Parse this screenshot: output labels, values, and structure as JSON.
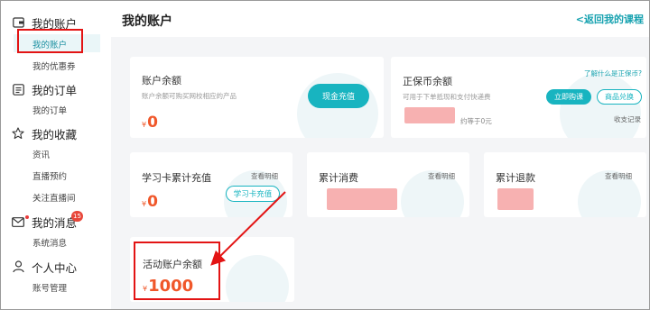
{
  "sidebar": {
    "groups": [
      {
        "title": "我的账户",
        "icon": "wallet-icon",
        "items": [
          "我的账户",
          "我的优惠券"
        ]
      },
      {
        "title": "我的订单",
        "icon": "list-icon",
        "items": [
          "我的订单"
        ]
      },
      {
        "title": "我的收藏",
        "icon": "star-icon",
        "items": [
          "资讯",
          "直播预约",
          "关注直播间"
        ]
      },
      {
        "title": "我的消息",
        "icon": "mail-icon",
        "items": [
          "系统消息"
        ],
        "badge": "15"
      },
      {
        "title": "个人中心",
        "icon": "user-icon",
        "items": [
          "账号管理"
        ]
      }
    ]
  },
  "header": {
    "title": "我的账户",
    "back_link": "<返回我的课程"
  },
  "cards": {
    "account": {
      "title": "账户余额",
      "desc": "账户余额可购买网校相应的产品",
      "currency": "¥",
      "amount": "0",
      "button": "现金充值"
    },
    "coin": {
      "title": "正保币余额",
      "desc": "可用于下单抵现和支付快递费",
      "help_link": "了解什么是正保币?",
      "buy_button": "立即购课",
      "redeem_button": "商品兑换",
      "equiv": "约等于0元",
      "record_link": "收支记录"
    },
    "study_card": {
      "title": "学习卡累计充值",
      "detail_link": "查看明细",
      "currency": "¥",
      "amount": "0",
      "button": "学习卡充值"
    },
    "spend": {
      "title": "累计消费",
      "detail_link": "查看明细"
    },
    "refund": {
      "title": "累计退款",
      "detail_link": "查看明细"
    },
    "activity": {
      "title": "活动账户余额",
      "currency": "¥",
      "amount": "1000"
    }
  },
  "colors": {
    "accent": "#18b4c0",
    "amount": "#f0572a",
    "highlight": "#e31414"
  }
}
